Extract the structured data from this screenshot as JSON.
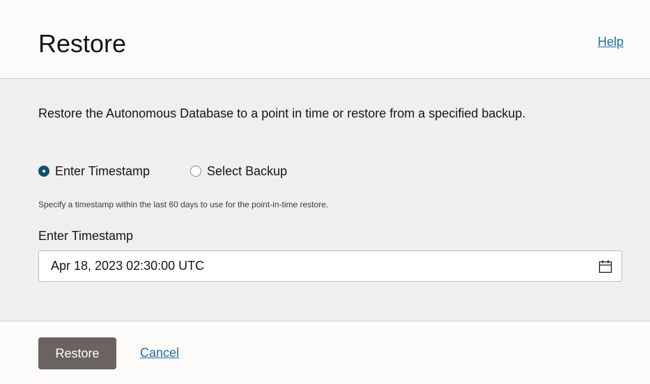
{
  "header": {
    "title": "Restore",
    "help_label": "Help"
  },
  "body": {
    "description": "Restore the Autonomous Database to a point in time or restore from a specified backup.",
    "restore_options": [
      {
        "label": "Enter Timestamp",
        "selected": true
      },
      {
        "label": "Select Backup",
        "selected": false
      }
    ],
    "hint": "Specify a timestamp within the last 60 days to use for the point-in-time restore.",
    "timestamp_field": {
      "label": "Enter Timestamp",
      "value": "Apr 18, 2023 02:30:00 UTC",
      "icon": "calendar-icon"
    }
  },
  "footer": {
    "restore_label": "Restore",
    "cancel_label": "Cancel"
  },
  "colors": {
    "primary_button": "#6a635f",
    "link": "#1f6fa6",
    "radio_selected": "#14506f",
    "body_background": "#f1efed"
  }
}
